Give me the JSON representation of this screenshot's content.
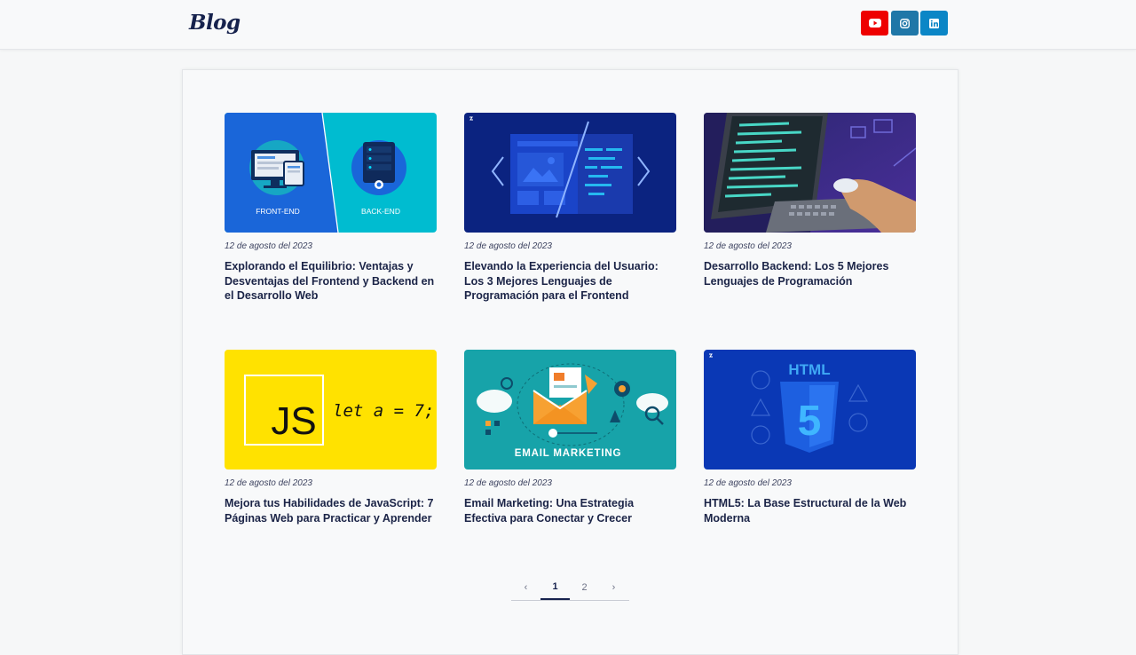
{
  "header": {
    "logo": "Blog",
    "social": [
      {
        "name": "youtube-icon",
        "color": "#ee0000"
      },
      {
        "name": "instagram-icon",
        "color": "#1f77a8"
      },
      {
        "name": "linkedin-icon",
        "color": "#0b86c6"
      }
    ]
  },
  "posts": [
    {
      "date": "12 de agosto del 2023",
      "title": "Explorando el Equilibrio: Ventajas y Desventajas del Frontend y Backend en el Desarrollo Web",
      "image": {
        "left_label": "FRONT-END",
        "right_label": "BACK-END"
      }
    },
    {
      "date": "12 de agosto del 2023",
      "title": "Elevando la Experiencia del Usuario: Los 3 Mejores Lenguajes de Programación para el Frontend"
    },
    {
      "date": "12 de agosto del 2023",
      "title": "Desarrollo Backend: Los 5 Mejores Lenguajes de Programación"
    },
    {
      "date": "12 de agosto del 2023",
      "title": "Mejora tus Habilidades de JavaScript: 7 Páginas Web para Practicar y Aprender",
      "image": {
        "badge": "JS",
        "code": "let a = 7;"
      }
    },
    {
      "date": "12 de agosto del 2023",
      "title": "Email Marketing: Una Estrategia Efectiva para Conectar y Crecer",
      "image": {
        "caption": "EMAIL MARKETING"
      }
    },
    {
      "date": "12 de agosto del 2023",
      "title": "HTML5: La Base Estructural de la Web Moderna",
      "image": {
        "heading": "HTML",
        "number": "5"
      }
    }
  ],
  "pagination": {
    "prev": "‹",
    "pages": [
      "1",
      "2"
    ],
    "current": "1",
    "next": "›"
  }
}
